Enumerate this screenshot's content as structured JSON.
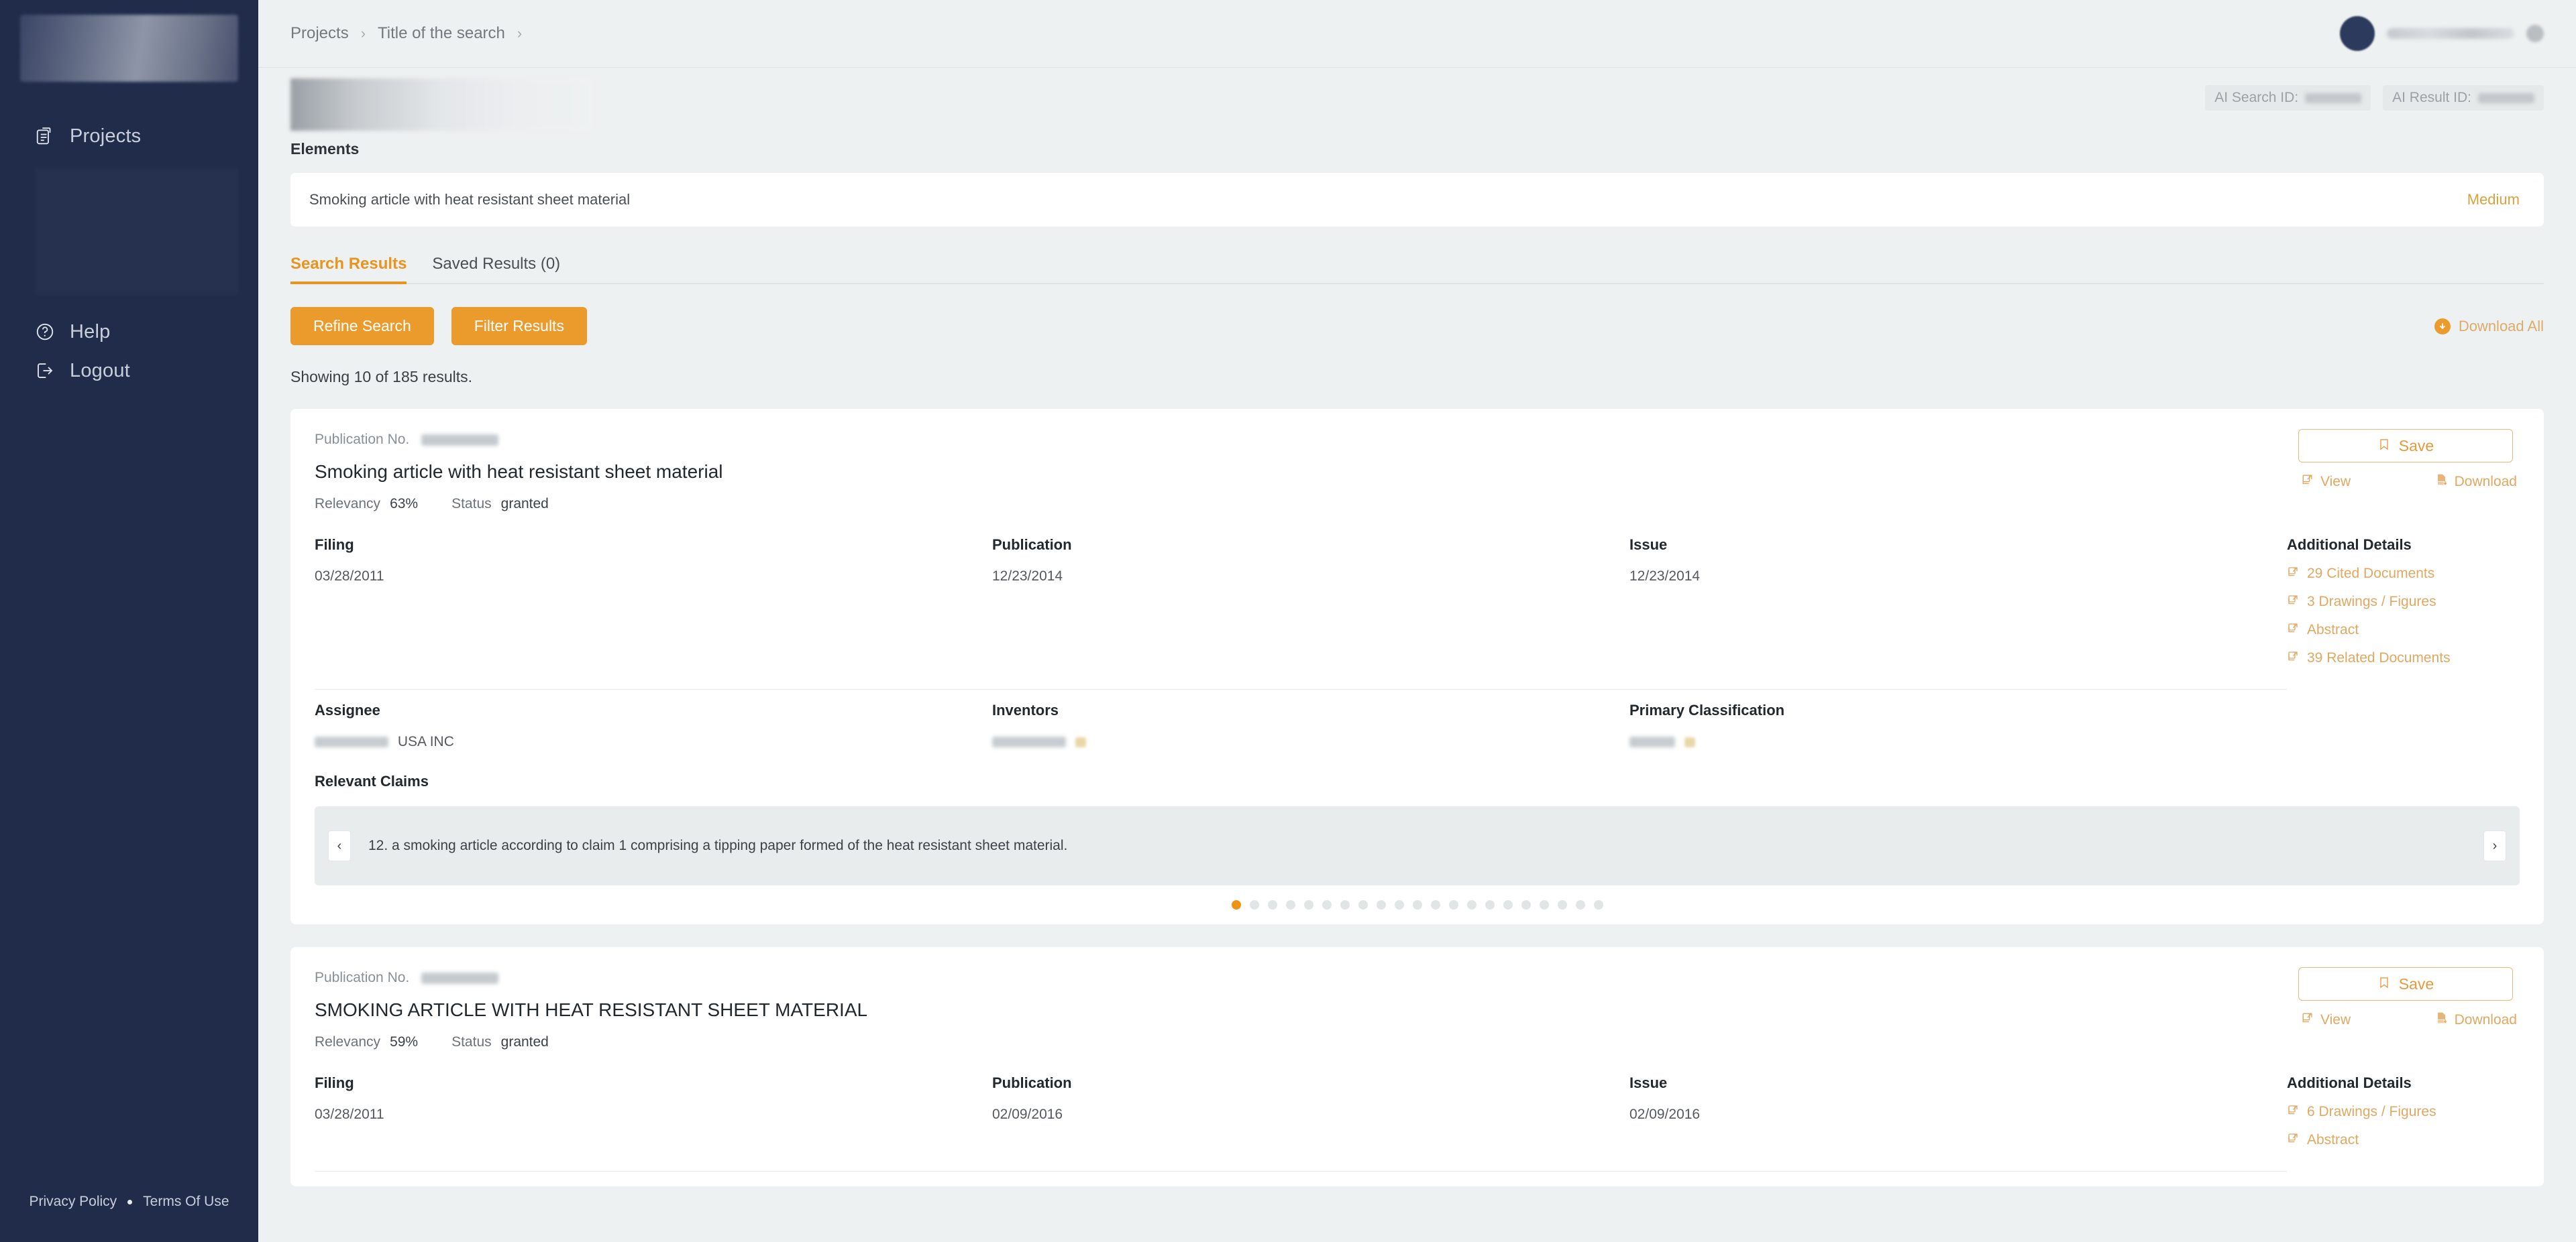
{
  "sidebar": {
    "logo": "brand-logo-placeholder",
    "items": [
      {
        "label": "Projects",
        "icon": "clipboard-list-icon"
      },
      {
        "label": "Help",
        "icon": "question-circle-icon"
      },
      {
        "label": "Logout",
        "icon": "logout-icon"
      }
    ],
    "footer": {
      "privacy": "Privacy Policy",
      "separator": "•",
      "terms": "Terms Of Use"
    }
  },
  "topbar": {
    "breadcrumb": [
      {
        "label": "Projects"
      },
      {
        "label": "Title of the search"
      }
    ],
    "separator": "›",
    "user": {
      "name_redacted": true,
      "avatar": "user-avatar",
      "gear": "gear-icon"
    }
  },
  "hero": {
    "ids": [
      {
        "label": "AI Search ID:",
        "value_redacted": true
      },
      {
        "label": "AI Result ID:",
        "value_redacted": true
      }
    ]
  },
  "elements": {
    "heading": "Elements",
    "rows": [
      {
        "text": "Smoking article with heat resistant sheet material",
        "priority": "Medium"
      }
    ]
  },
  "tabs": [
    {
      "label": "Search Results",
      "active": true
    },
    {
      "label": "Saved Results (0)",
      "active": false
    }
  ],
  "toolbar": {
    "refine_label": "Refine Search",
    "filter_label": "Filter Results",
    "download_all_label": "Download All",
    "download_all_icon": "download-circle-icon"
  },
  "showing": "Showing 10 of 185 results.",
  "labels": {
    "publication_no": "Publication No.",
    "relevancy": "Relevancy",
    "status": "Status",
    "filing": "Filing",
    "publication": "Publication",
    "issue": "Issue",
    "assignee": "Assignee",
    "inventors": "Inventors",
    "primary_classification": "Primary Classification",
    "additional_details": "Additional Details",
    "relevant_claims": "Relevant Claims",
    "save": "Save",
    "view": "View",
    "download": "Download",
    "prev": "‹",
    "next": "›"
  },
  "colors": {
    "accent": "#eb9a2c",
    "accent_soft": "#e0a861",
    "sidebar_bg": "#212c4b",
    "page_bg": "#eef1f1",
    "card_bg": "#ffffff",
    "priority_medium": "#d6a33f"
  },
  "results": [
    {
      "publication_no_redacted": true,
      "title": "Smoking article with heat resistant sheet material",
      "relevancy": "63%",
      "status": "granted",
      "filing": "03/28/2011",
      "publication": "12/23/2014",
      "issue": "12/23/2014",
      "assignee_suffix": "USA INC",
      "assignee_redacted": true,
      "inventors_redacted": true,
      "primary_classification_redacted": true,
      "additional_details": [
        "29 Cited Documents",
        "3 Drawings / Figures",
        "Abstract",
        "39 Related Documents"
      ],
      "claims": {
        "current_text": "12. a smoking article according to claim 1 comprising a tipping paper formed of the heat resistant sheet material.",
        "total": 21,
        "active_index": 0
      }
    },
    {
      "publication_no_redacted": true,
      "title": "SMOKING ARTICLE WITH HEAT RESISTANT SHEET MATERIAL",
      "relevancy": "59%",
      "status": "granted",
      "filing": "03/28/2011",
      "publication": "02/09/2016",
      "issue": "02/09/2016",
      "additional_details": [
        "6 Drawings / Figures",
        "Abstract"
      ]
    }
  ]
}
